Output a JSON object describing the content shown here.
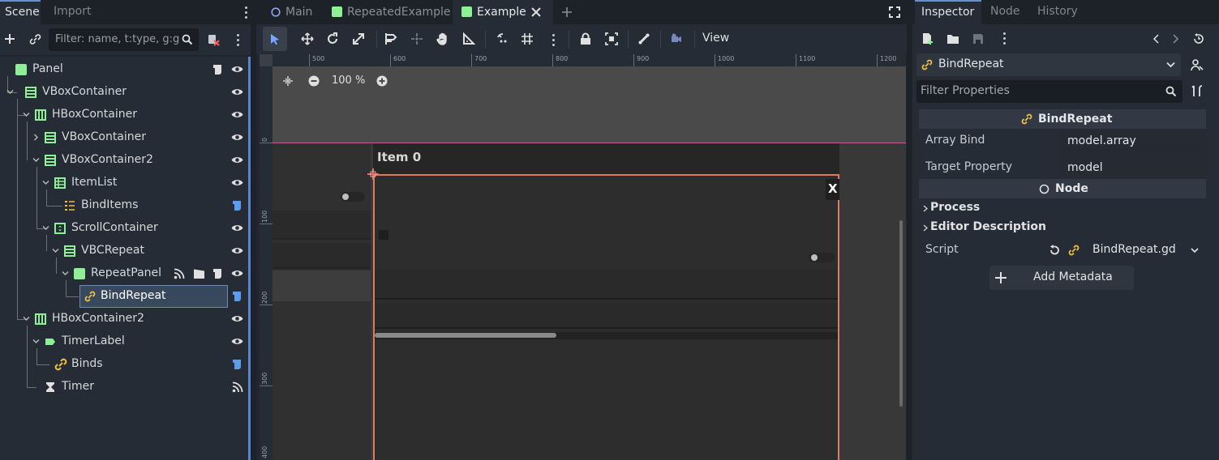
{
  "left_dock": {
    "tabs": [
      "Scene",
      "Import"
    ],
    "filter_placeholder": "Filter: name, t:type, g:g",
    "tree": [
      {
        "label": "Panel",
        "icon": "panel-icon"
      },
      {
        "label": "VBoxContainer",
        "icon": "vbox-icon"
      },
      {
        "label": "HBoxContainer",
        "icon": "hbox-icon"
      },
      {
        "label": "VBoxContainer",
        "icon": "vbox-icon"
      },
      {
        "label": "VBoxContainer2",
        "icon": "vbox-icon"
      },
      {
        "label": "ItemList",
        "icon": "itemlist-icon"
      },
      {
        "label": "BindItems",
        "icon": "binditems-icon"
      },
      {
        "label": "ScrollContainer",
        "icon": "scroll-icon"
      },
      {
        "label": "VBCRepeat",
        "icon": "vbox-icon"
      },
      {
        "label": "RepeatPanel",
        "icon": "panel-icon"
      },
      {
        "label": "BindRepeat",
        "icon": "chain-icon"
      },
      {
        "label": "HBoxContainer2",
        "icon": "hbox-icon"
      },
      {
        "label": "TimerLabel",
        "icon": "label-icon"
      },
      {
        "label": "Binds",
        "icon": "link-icon"
      },
      {
        "label": "Timer",
        "icon": "hourglass-icon"
      }
    ]
  },
  "center": {
    "tabs": [
      {
        "label": "Main",
        "icon": "circle-icon"
      },
      {
        "label": "RepeatedExample",
        "icon": "panel-icon"
      },
      {
        "label": "Example",
        "icon": "panel-icon"
      }
    ],
    "view_menu": "View",
    "zoom": "100 %",
    "ruler_top": [
      "500",
      "600",
      "700",
      "800",
      "900",
      "1000",
      "1100",
      "1200"
    ],
    "ruler_left": [
      "0",
      "100",
      "200",
      "300",
      "400"
    ],
    "canvas": {
      "item_label": "Item 0",
      "close_label": "X"
    }
  },
  "right_dock": {
    "tabs": [
      "Inspector",
      "Node",
      "History"
    ],
    "object_name": "BindRepeat",
    "filter_placeholder": "Filter Properties",
    "section_title": "BindRepeat",
    "properties": [
      {
        "name": "Array Bind",
        "value": "model.array"
      },
      {
        "name": "Target Property",
        "value": "model"
      }
    ],
    "node_section": "Node",
    "groups": [
      "Process",
      "Editor Description"
    ],
    "script_label": "Script",
    "script_value": "BindRepeat.gd",
    "add_metadata": "Add Metadata"
  },
  "colors": {
    "accent": "#5785d4",
    "node_green": "#8eef97",
    "selection_orange": "#e07a5f"
  }
}
